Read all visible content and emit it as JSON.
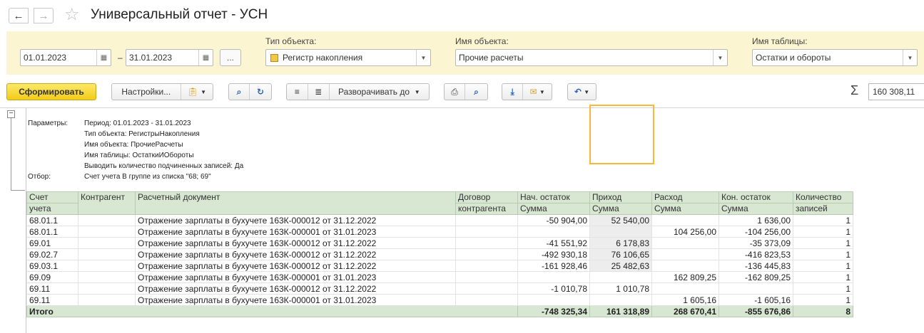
{
  "window": {
    "title": "Универсальный отчет - УСН",
    "back_icon": "arrow-left-icon",
    "forward_icon": "arrow-right-icon",
    "favorite_icon": "star-icon"
  },
  "filters": {
    "date_from": "01.01.2023",
    "date_to": "31.01.2023",
    "dash": "–",
    "dots_label": "...",
    "object_type_label": "Тип объекта:",
    "object_type_value": "Регистр накопления",
    "object_name_label": "Имя объекта:",
    "object_name_value": "Прочие расчеты",
    "table_name_label": "Имя таблицы:",
    "table_name_value": "Остатки и обороты"
  },
  "toolbar": {
    "generate_label": "Сформировать",
    "settings_label": "Настройки...",
    "expand_label": "Разворачивать до",
    "sum_value": "160 308,11",
    "sigma": "Σ"
  },
  "params": {
    "params_label": "Параметры:",
    "period": "Период: 01.01.2023 - 31.01.2023",
    "object_type": "Тип объекта: РегистрыНакопления",
    "object_name": "Имя объекта: ПрочиеРасчеты",
    "table_name": "Имя таблицы: ОстаткиИОбороты",
    "show_count": "Выводить количество подчиненных записей: Да",
    "filter_label": "Отбор:",
    "filter_value": "Счет учета В группе из списка \"68; 69\""
  },
  "table": {
    "headers": {
      "account_1": "Счет",
      "account_2": "учета",
      "counterparty": "Контрагент",
      "document": "Расчетный документ",
      "contract_1": "Договор",
      "contract_2": "контрагента",
      "start_1": "Нач. остаток",
      "start_2": "Сумма",
      "income_1": "Приход",
      "income_2": "Сумма",
      "expense_1": "Расход",
      "expense_2": "Сумма",
      "end_1": "Кон. остаток",
      "end_2": "Сумма",
      "count_1": "Количество",
      "count_2": "записей"
    },
    "rows": [
      {
        "account": "68.01.1",
        "counterparty": "",
        "document": "Отражение зарплаты в бухучете 163К-000012 от 31.12.2022",
        "contract": "",
        "start": "-50 904,00",
        "income": "52 540,00",
        "expense": "",
        "end": "1 636,00",
        "count": "1"
      },
      {
        "account": "68.01.1",
        "counterparty": "",
        "document": "Отражение зарплаты в бухучете 163К-000001 от 31.01.2023",
        "contract": "",
        "start": "",
        "income": "",
        "expense": "104 256,00",
        "end": "-104 256,00",
        "count": "1"
      },
      {
        "account": "69.01",
        "counterparty": "",
        "document": "Отражение зарплаты в бухучете 163К-000012 от 31.12.2022",
        "contract": "",
        "start": "-41 551,92",
        "income": "6 178,83",
        "expense": "",
        "end": "-35 373,09",
        "count": "1"
      },
      {
        "account": "69.02.7",
        "counterparty": "",
        "document": "Отражение зарплаты в бухучете 163К-000012 от 31.12.2022",
        "contract": "",
        "start": "-492 930,18",
        "income": "76 106,65",
        "expense": "",
        "end": "-416 823,53",
        "count": "1"
      },
      {
        "account": "69.03.1",
        "counterparty": "",
        "document": "Отражение зарплаты в бухучете 163К-000012 от 31.12.2022",
        "contract": "",
        "start": "-161 928,46",
        "income": "25 482,63",
        "expense": "",
        "end": "-136 445,83",
        "count": "1"
      },
      {
        "account": "69.09",
        "counterparty": "",
        "document": "Отражение зарплаты в бухучете 163К-000001 от 31.01.2023",
        "contract": "",
        "start": "",
        "income": "",
        "expense": "162 809,25",
        "end": "-162 809,25",
        "count": "1"
      },
      {
        "account": "69.11",
        "counterparty": "",
        "document": "Отражение зарплаты в бухучете 163К-000012 от 31.12.2022",
        "contract": "",
        "start": "-1 010,78",
        "income": "1 010,78",
        "expense": "",
        "end": "",
        "count": "1"
      },
      {
        "account": "69.11",
        "counterparty": "",
        "document": "Отражение зарплаты в бухучете 163К-000001 от 31.01.2023",
        "contract": "",
        "start": "",
        "income": "",
        "expense": "1 605,16",
        "end": "-1 605,16",
        "count": "1"
      }
    ],
    "total": {
      "label": "Итого",
      "start": "-748 325,34",
      "income": "161 318,89",
      "expense": "268 670,41",
      "end": "-855 676,86",
      "count": "8"
    }
  }
}
